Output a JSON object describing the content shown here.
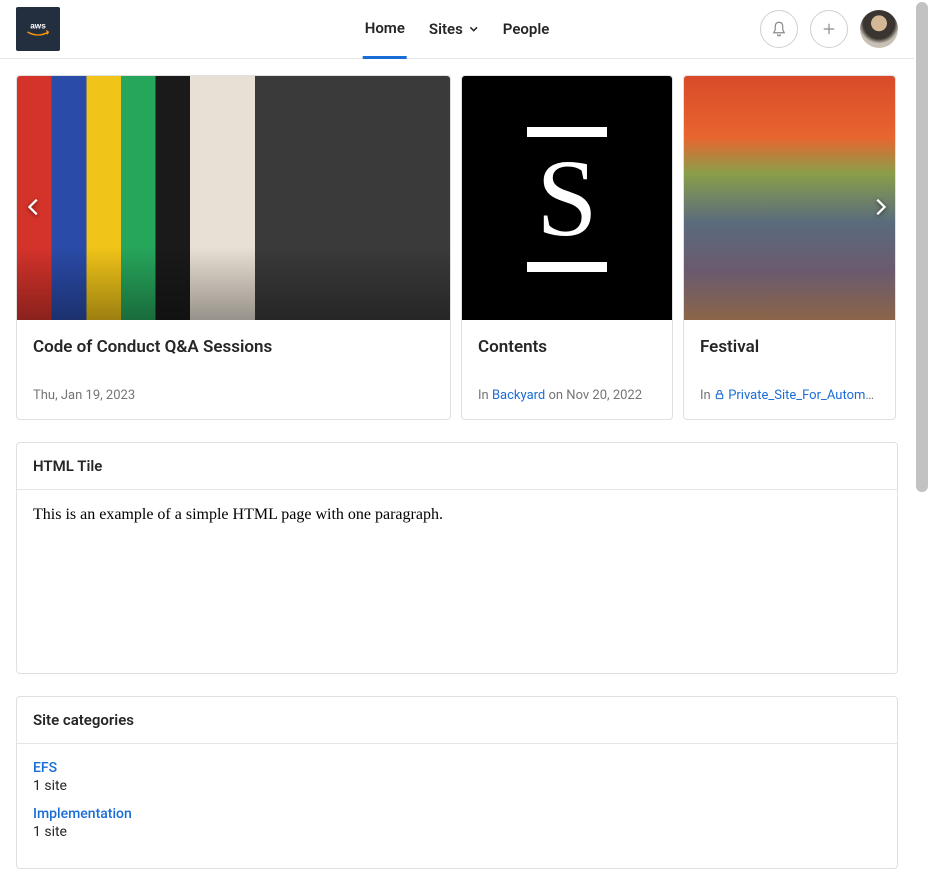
{
  "header": {
    "nav": {
      "home": "Home",
      "sites": "Sites",
      "people": "People"
    }
  },
  "carousel": {
    "cards": [
      {
        "title": "Code of Conduct Q&A Sessions",
        "meta_prefix": "",
        "meta_link": "",
        "meta_suffix": "Thu, Jan 19, 2023"
      },
      {
        "title": "Contents",
        "meta_prefix": "In ",
        "meta_link": "Backyard",
        "meta_suffix": " on Nov 20, 2022"
      },
      {
        "title": "Festival",
        "meta_prefix": "In ",
        "meta_link": "Private_Site_For_Automati…",
        "meta_suffix": "",
        "locked": true
      }
    ]
  },
  "html_tile": {
    "title": "HTML Tile",
    "paragraph": "This is an example of a simple HTML page with one paragraph."
  },
  "categories": {
    "title": "Site categories",
    "items": [
      {
        "name": "EFS",
        "count_text": "1 site"
      },
      {
        "name": "Implementation",
        "count_text": "1 site"
      }
    ]
  }
}
